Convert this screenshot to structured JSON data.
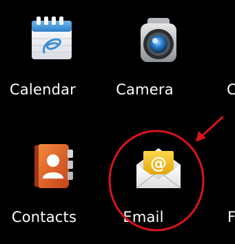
{
  "apps": [
    {
      "id": "calendar",
      "label": "Calendar",
      "icon": "calendar-icon"
    },
    {
      "id": "camera",
      "label": "Camera",
      "icon": "camera-icon"
    },
    {
      "id": "contacts",
      "label": "Contacts",
      "icon": "contacts-icon"
    },
    {
      "id": "email",
      "label": "Email",
      "icon": "email-icon"
    }
  ],
  "partial_labels": {
    "row1_right": "C",
    "row2_right": "F"
  },
  "annotation": {
    "circle_color": "#d9141a",
    "arrow_color": "#d9141a",
    "target": "email"
  },
  "colors": {
    "background": "#000000",
    "label_text": "#ffffff",
    "calendar_blue": "#5aa7e6",
    "contacts_orange": "#e8632a",
    "email_yellow": "#f2c21a"
  }
}
